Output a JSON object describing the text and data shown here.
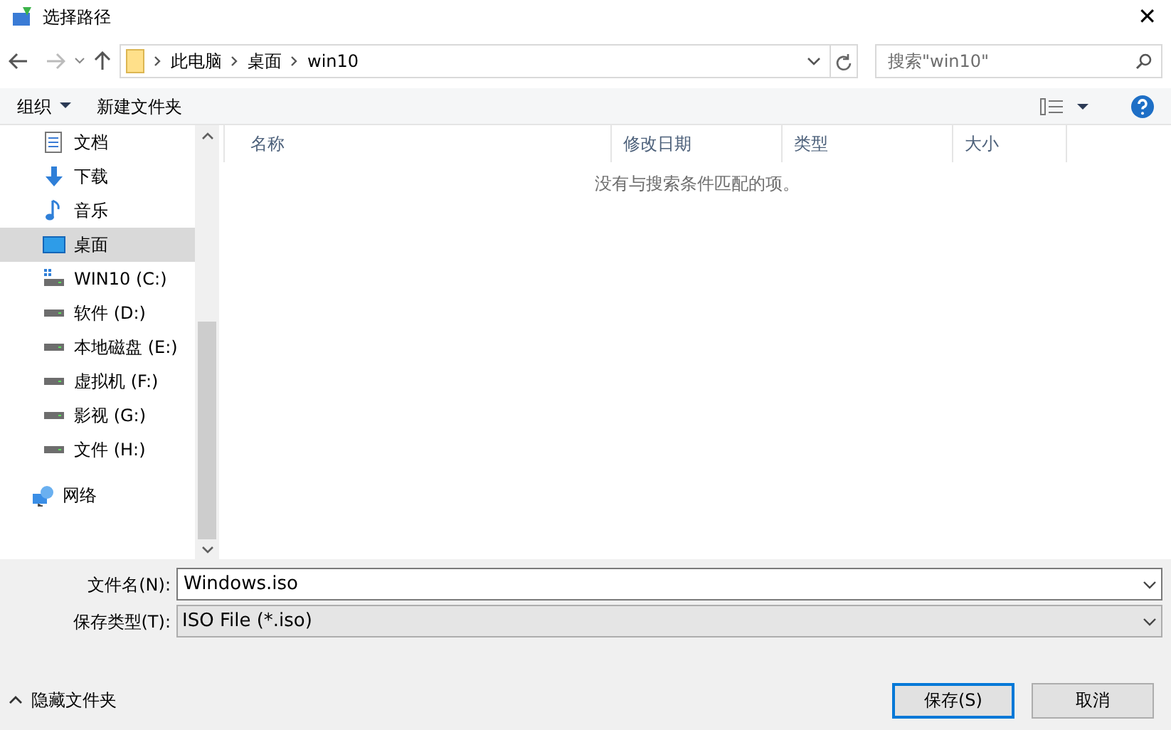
{
  "window": {
    "title": "选择路径",
    "close": "✕"
  },
  "address": {
    "crumbs": [
      "此电脑",
      "桌面",
      "win10"
    ]
  },
  "search": {
    "placeholder": "搜索\"win10\""
  },
  "toolbar": {
    "organize": "组织",
    "new_folder": "新建文件夹"
  },
  "sidebar": {
    "items": [
      {
        "label": "文档",
        "kind": "document",
        "selected": false
      },
      {
        "label": "下载",
        "kind": "download",
        "selected": false
      },
      {
        "label": "音乐",
        "kind": "music",
        "selected": false
      },
      {
        "label": "桌面",
        "kind": "desktop",
        "selected": true
      },
      {
        "label": "WIN10 (C:)",
        "kind": "system-drive",
        "selected": false
      },
      {
        "label": "软件 (D:)",
        "kind": "drive",
        "selected": false
      },
      {
        "label": "本地磁盘 (E:)",
        "kind": "drive",
        "selected": false
      },
      {
        "label": "虚拟机 (F:)",
        "kind": "drive",
        "selected": false
      },
      {
        "label": "影视 (G:)",
        "kind": "drive",
        "selected": false
      },
      {
        "label": "文件 (H:)",
        "kind": "drive",
        "selected": false
      },
      {
        "label": "网络",
        "kind": "network",
        "selected": false
      }
    ]
  },
  "table": {
    "columns": [
      "名称",
      "修改日期",
      "类型",
      "大小"
    ],
    "empty_message": "没有与搜索条件匹配的项。"
  },
  "form": {
    "filename_label": "文件名(N):",
    "filename": "Windows.iso",
    "type_label": "保存类型(T):",
    "type": "ISO File (*.iso)"
  },
  "footer": {
    "hide_folders": "隐藏文件夹",
    "buttons": [
      "保存(S)",
      "取消"
    ]
  }
}
